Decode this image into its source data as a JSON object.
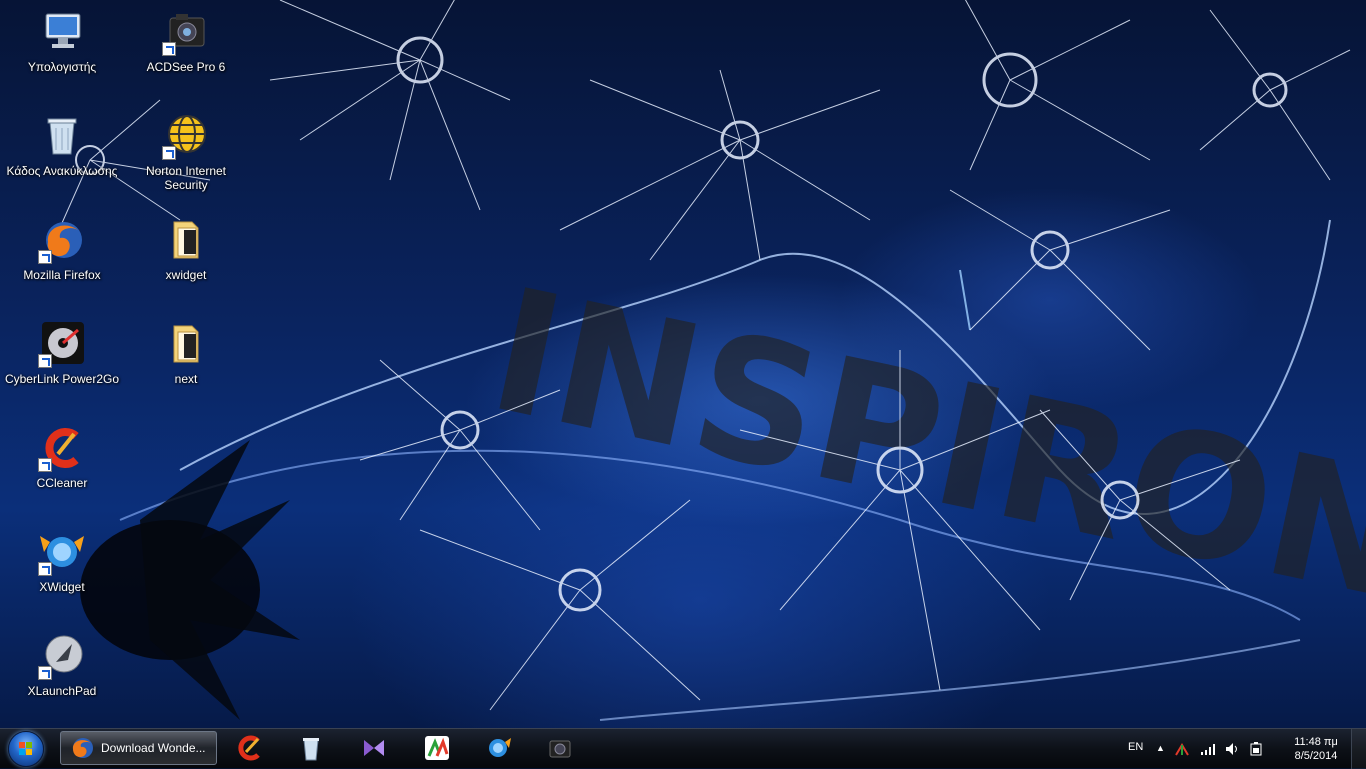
{
  "desktop": {
    "icons": [
      {
        "label": "Υπολογιστής",
        "icon": "computer-icon"
      },
      {
        "label": "ACDSee Pro 6",
        "icon": "camera-icon"
      },
      {
        "label": "Κάδος Ανακύκλωσης",
        "icon": "recycle-bin-icon"
      },
      {
        "label": "Norton Internet Security",
        "icon": "norton-icon"
      },
      {
        "label": "Mozilla Firefox",
        "icon": "firefox-icon"
      },
      {
        "label": "xwidget",
        "icon": "folder-icon"
      },
      {
        "label": "CyberLink Power2Go",
        "icon": "disc-icon"
      },
      {
        "label": "next",
        "icon": "folder-icon"
      },
      {
        "label": "CCleaner",
        "icon": "ccleaner-icon"
      },
      {
        "label": "XWidget",
        "icon": "xwidget-icon"
      },
      {
        "label": "XLaunchPad",
        "icon": "rocket-icon"
      }
    ],
    "wallpaper_text": "INSPIRON"
  },
  "taskbar": {
    "active_task": {
      "label": "Download Wonde...",
      "icon": "firefox-icon"
    },
    "pinned": [
      "ccleaner-icon",
      "recycle-bin-icon",
      "visual-studio-icon",
      "chart-icon",
      "xwidget-icon",
      "camera-icon"
    ],
    "tray": {
      "language": "EN",
      "clock_time": "11:48 πμ",
      "clock_date": "8/5/2014"
    }
  },
  "colors": {
    "accent": "#2266c9",
    "taskbar": "#0d1118"
  }
}
